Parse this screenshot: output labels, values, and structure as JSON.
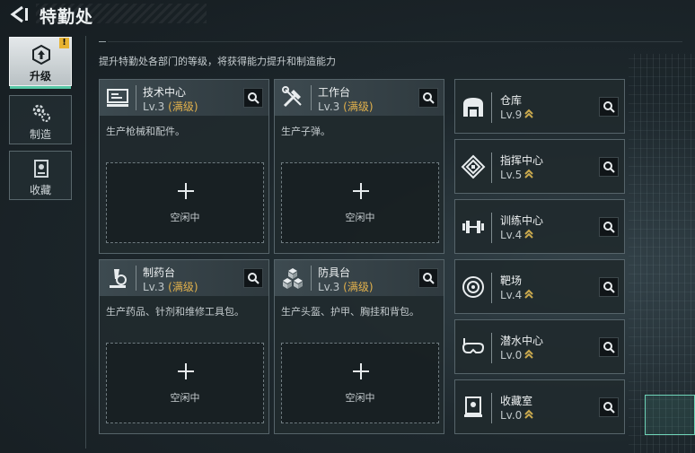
{
  "header": {
    "title": "特勤处"
  },
  "nav": [
    {
      "label": "升级",
      "icon": "upgrade-icon",
      "active": true,
      "badge": "!"
    },
    {
      "label": "制造",
      "icon": "gears-icon",
      "active": false
    },
    {
      "label": "收藏",
      "icon": "collection-icon",
      "active": false
    }
  ],
  "subtitle": "提升特勤处各部门的等级，将获得能力提升和制造能力",
  "idle_plus": "+",
  "cards": [
    {
      "name": "技术中心",
      "level": "Lv.3",
      "status": "(满级)",
      "desc": "生产枪械和配件。",
      "slot": "空闲中",
      "icon": "computer-icon"
    },
    {
      "name": "工作台",
      "level": "Lv.3",
      "status": "(满级)",
      "desc": "生产子弹。",
      "slot": "空闲中",
      "icon": "tools-icon"
    },
    {
      "name": "制药台",
      "level": "Lv.3",
      "status": "(满级)",
      "desc": "生产药品、针剂和维修工具包。",
      "slot": "空闲中",
      "icon": "microscope-icon"
    },
    {
      "name": "防具台",
      "level": "Lv.3",
      "status": "(满级)",
      "desc": "生产头盔、护甲、胸挂和背包。",
      "slot": "空闲中",
      "icon": "boxes-icon"
    }
  ],
  "facilities": [
    {
      "name": "仓库",
      "level": "Lv.9",
      "icon": "warehouse-icon"
    },
    {
      "name": "指挥中心",
      "level": "Lv.5",
      "icon": "command-icon"
    },
    {
      "name": "训练中心",
      "level": "Lv.4",
      "icon": "dumbbell-icon"
    },
    {
      "name": "靶场",
      "level": "Lv.4",
      "icon": "target-icon"
    },
    {
      "name": "潜水中心",
      "level": "Lv.0",
      "icon": "diving-mask-icon"
    },
    {
      "name": "收藏室",
      "level": "Lv.0",
      "icon": "display-case-icon"
    }
  ],
  "colors": {
    "accent": "#57c8a6",
    "max_level": "#e2b14c",
    "badge": "#e7b331"
  }
}
